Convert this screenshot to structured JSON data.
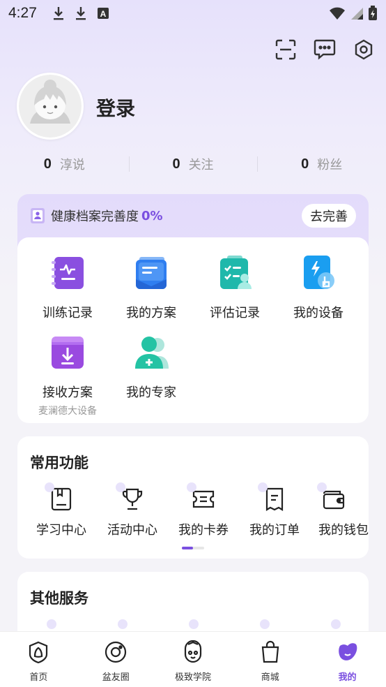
{
  "status_bar": {
    "time": "4:27",
    "left_icons": [
      "download-icon",
      "download-icon",
      "a-notification-icon"
    ],
    "right_icons": [
      "wifi-icon",
      "signal-icon",
      "battery-icon"
    ]
  },
  "top_actions": [
    "scan-icon",
    "message-icon",
    "settings-icon"
  ],
  "profile": {
    "login_label": "登录"
  },
  "stats": [
    {
      "num": "0",
      "label": "淳说"
    },
    {
      "num": "0",
      "label": "关注"
    },
    {
      "num": "0",
      "label": "粉丝"
    }
  ],
  "health": {
    "label": "健康档案完善度",
    "percent": "0%",
    "button": "去完善",
    "items": [
      {
        "label": "训练记录",
        "icon": "training-record-icon"
      },
      {
        "label": "我的方案",
        "icon": "my-plan-icon"
      },
      {
        "label": "评估记录",
        "icon": "assessment-record-icon"
      },
      {
        "label": "我的设备",
        "icon": "my-device-icon"
      },
      {
        "label": "接收方案",
        "sub": "麦澜德大设备",
        "icon": "receive-plan-icon"
      },
      {
        "label": "我的专家",
        "icon": "my-expert-icon"
      }
    ]
  },
  "common": {
    "title": "常用功能",
    "items": [
      {
        "label": "学习中心",
        "icon": "book-icon"
      },
      {
        "label": "活动中心",
        "icon": "trophy-icon"
      },
      {
        "label": "我的卡券",
        "icon": "coupon-icon"
      },
      {
        "label": "我的订单",
        "icon": "order-icon"
      },
      {
        "label": "我的钱包",
        "icon": "wallet-icon"
      }
    ]
  },
  "other": {
    "title": "其他服务"
  },
  "nav": [
    {
      "label": "首页",
      "icon": "home-icon"
    },
    {
      "label": "盆友圈",
      "icon": "circle-icon"
    },
    {
      "label": "极致学院",
      "icon": "academy-icon"
    },
    {
      "label": "商城",
      "icon": "shop-icon"
    },
    {
      "label": "我的",
      "icon": "profile-icon",
      "active": true
    }
  ],
  "colors": {
    "accent": "#7a4fe0"
  }
}
